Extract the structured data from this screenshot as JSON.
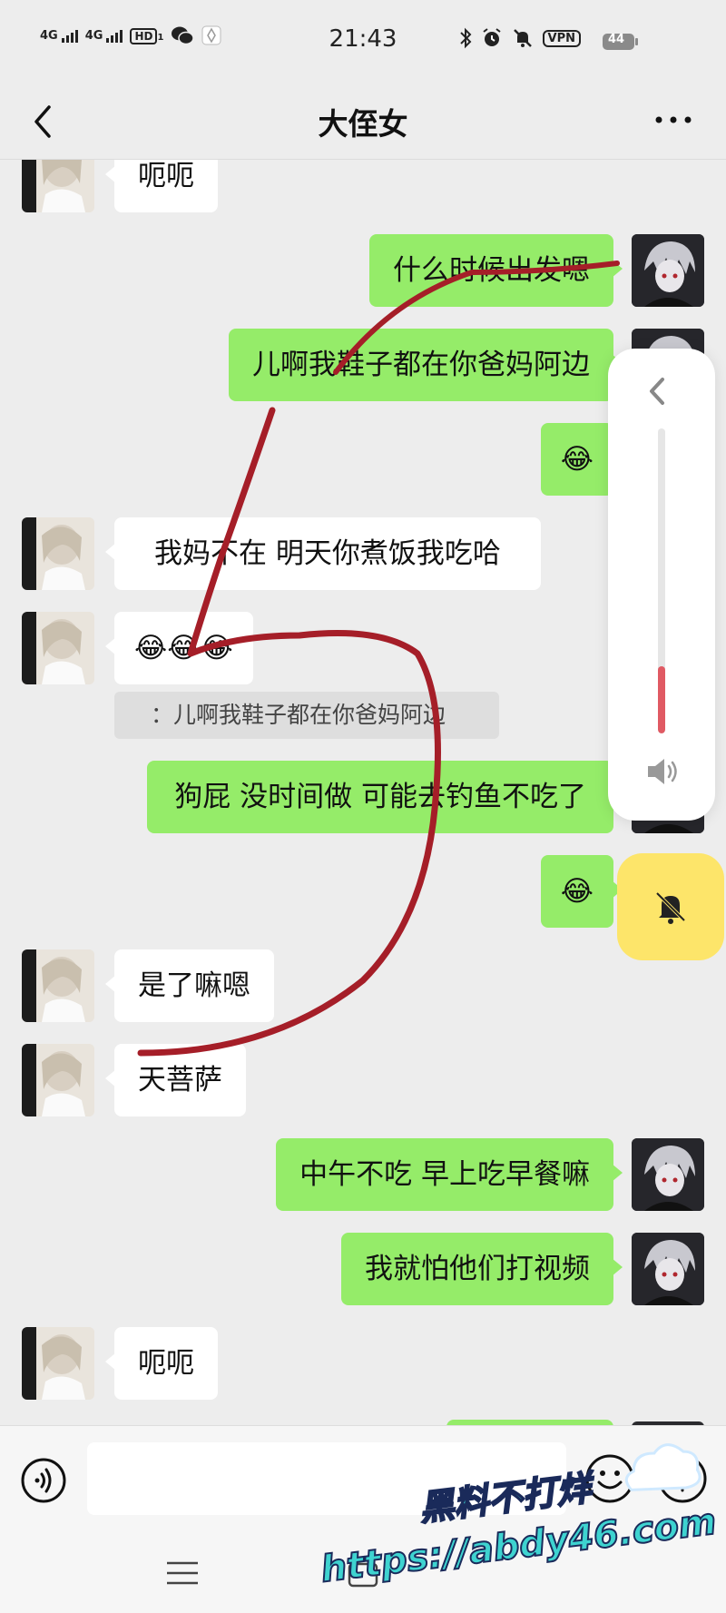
{
  "status_bar": {
    "network_1": "4G",
    "network_2": "4G",
    "hd_badge": "HD",
    "hd_sub": "1",
    "time": "21:43",
    "vpn": "VPN",
    "battery": "44"
  },
  "header": {
    "title": "大侄女"
  },
  "messages": [
    {
      "side": "in",
      "text": "呃呃"
    },
    {
      "side": "out",
      "text": "什么时候出发嗯"
    },
    {
      "side": "out",
      "text": "儿啊我鞋子都在你爸妈阿边"
    },
    {
      "side": "out",
      "text": "😂"
    },
    {
      "side": "in",
      "text": "我妈不在   明天你煮饭我吃哈"
    },
    {
      "side": "in",
      "text": "😂😂😂"
    },
    {
      "side": "out",
      "text": "狗屁 没时间做 可能去钓鱼不吃了"
    },
    {
      "side": "out",
      "text": "😂"
    },
    {
      "side": "in",
      "text": "是了嘛嗯"
    },
    {
      "side": "in",
      "text": "天菩萨"
    },
    {
      "side": "out",
      "text": "中午不吃 早上吃早餐嘛"
    },
    {
      "side": "out",
      "text": "我就怕他们打视频"
    },
    {
      "side": "in",
      "text": "呃呃"
    }
  ],
  "quote": {
    "text": "：儿啊我鞋子都在你爸妈阿边"
  },
  "volume_panel": {
    "level": 0.22,
    "fill_color": "#e05a63"
  },
  "input_bar": {
    "value": "",
    "voice_icon": "voice-icon",
    "emoji_icon": "emoji-icon",
    "plus_icon": "plus-icon"
  },
  "watermark": {
    "line1": "黑料不打烊",
    "line2": "https://abdy46.com"
  },
  "colors": {
    "outgoing_bubble": "#95ec69",
    "incoming_bubble": "#ffffff",
    "background": "#ededed",
    "mute_button": "#fde56a",
    "scribble": "#a51e28"
  }
}
